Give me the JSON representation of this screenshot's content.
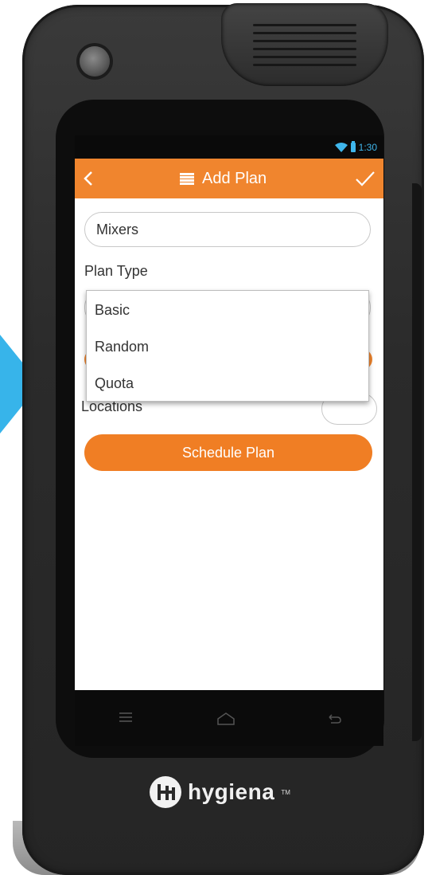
{
  "statusbar": {
    "time": "1:30"
  },
  "appbar": {
    "title": "Add Plan"
  },
  "form": {
    "plan_name_value": "Mixers",
    "plan_type_label": "Plan Type",
    "locations_label": "Locations",
    "schedule_button": "Schedule Plan"
  },
  "dropdown": {
    "options": [
      "Basic",
      "Random",
      "Quota"
    ]
  },
  "brand": {
    "name": "hygiena",
    "trademark": "TM"
  },
  "colors": {
    "accent": "#f0852e",
    "status": "#3fb6ec",
    "arrow": "#37b4ea"
  },
  "icons": {
    "back": "chevron-left-icon",
    "menu": "list-icon",
    "confirm": "checkmark-icon",
    "nav_menu": "menu-icon",
    "nav_home": "home-icon",
    "nav_back": "back-icon"
  }
}
